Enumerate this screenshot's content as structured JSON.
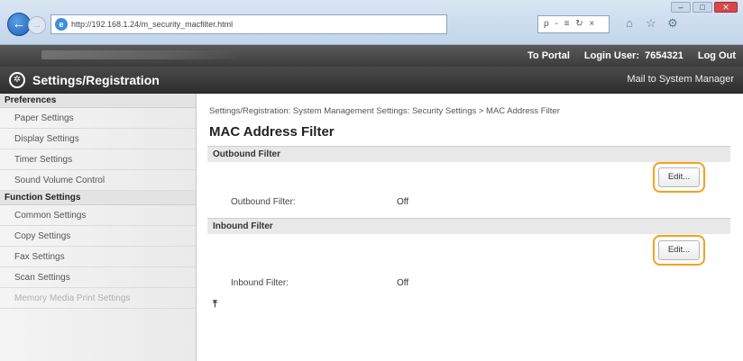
{
  "browser": {
    "url": "http://192.168.1.24/m_security_macfilter.html",
    "search_tools": "ρ - ≡ ↻ ×",
    "window_min": "–",
    "window_max": "□",
    "window_close": "✕",
    "back_glyph": "←",
    "forward_glyph": "→",
    "home_icon": "⌂",
    "star_icon": "☆",
    "settings_icon": "⚙"
  },
  "topbar": {
    "to_portal": "To Portal",
    "login_user_label": "Login User:",
    "login_user_value": "7654321",
    "log_out": "Log Out"
  },
  "titlebar": {
    "title": "Settings/Registration",
    "mail_link": "Mail to System Manager"
  },
  "sidebar": {
    "sections": [
      {
        "label": "Preferences",
        "items": [
          "Paper Settings",
          "Display Settings",
          "Timer Settings",
          "Sound Volume Control"
        ]
      },
      {
        "label": "Function Settings",
        "items": [
          "Common Settings",
          "Copy Settings",
          "Fax Settings",
          "Scan Settings",
          "Memory Media Print Settings"
        ]
      }
    ]
  },
  "main": {
    "breadcrumb": "Settings/Registration: System Management Settings: Security Settings > MAC Address Filter",
    "title": "MAC Address Filter",
    "outbound": {
      "header": "Outbound Filter",
      "edit_label": "Edit...",
      "field_label": "Outbound Filter:",
      "field_value": "Off"
    },
    "inbound": {
      "header": "Inbound Filter",
      "edit_label": "Edit...",
      "field_label": "Inbound Filter:",
      "field_value": "Off"
    },
    "top_arrow": "⤒"
  },
  "colors": {
    "highlight": "#f4a21c",
    "topbar": "#3c3c3c",
    "ie_blue": "#3f8fd8"
  }
}
